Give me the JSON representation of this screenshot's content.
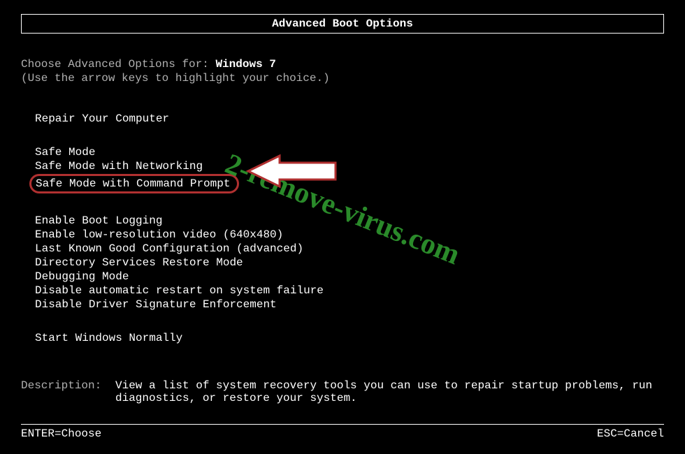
{
  "title": "Advanced Boot Options",
  "prompt": {
    "line1_prefix": "Choose Advanced Options for: ",
    "os_name": "Windows 7",
    "line2": "(Use the arrow keys to highlight your choice.)"
  },
  "options": {
    "repair": "Repair Your Computer",
    "safe_mode": "Safe Mode",
    "safe_mode_net": "Safe Mode with Networking",
    "safe_mode_cmd": "Safe Mode with Command Prompt",
    "boot_logging": "Enable Boot Logging",
    "low_res": "Enable low-resolution video (640x480)",
    "last_known": "Last Known Good Configuration (advanced)",
    "ds_restore": "Directory Services Restore Mode",
    "debugging": "Debugging Mode",
    "disable_restart": "Disable automatic restart on system failure",
    "disable_driver_sig": "Disable Driver Signature Enforcement",
    "start_normal": "Start Windows Normally"
  },
  "description": {
    "label": "Description:",
    "text": "View a list of system recovery tools you can use to repair startup problems, run diagnostics, or restore your system."
  },
  "footer": {
    "enter": "ENTER=Choose",
    "esc": "ESC=Cancel"
  },
  "watermark": "2-remove-virus.com"
}
